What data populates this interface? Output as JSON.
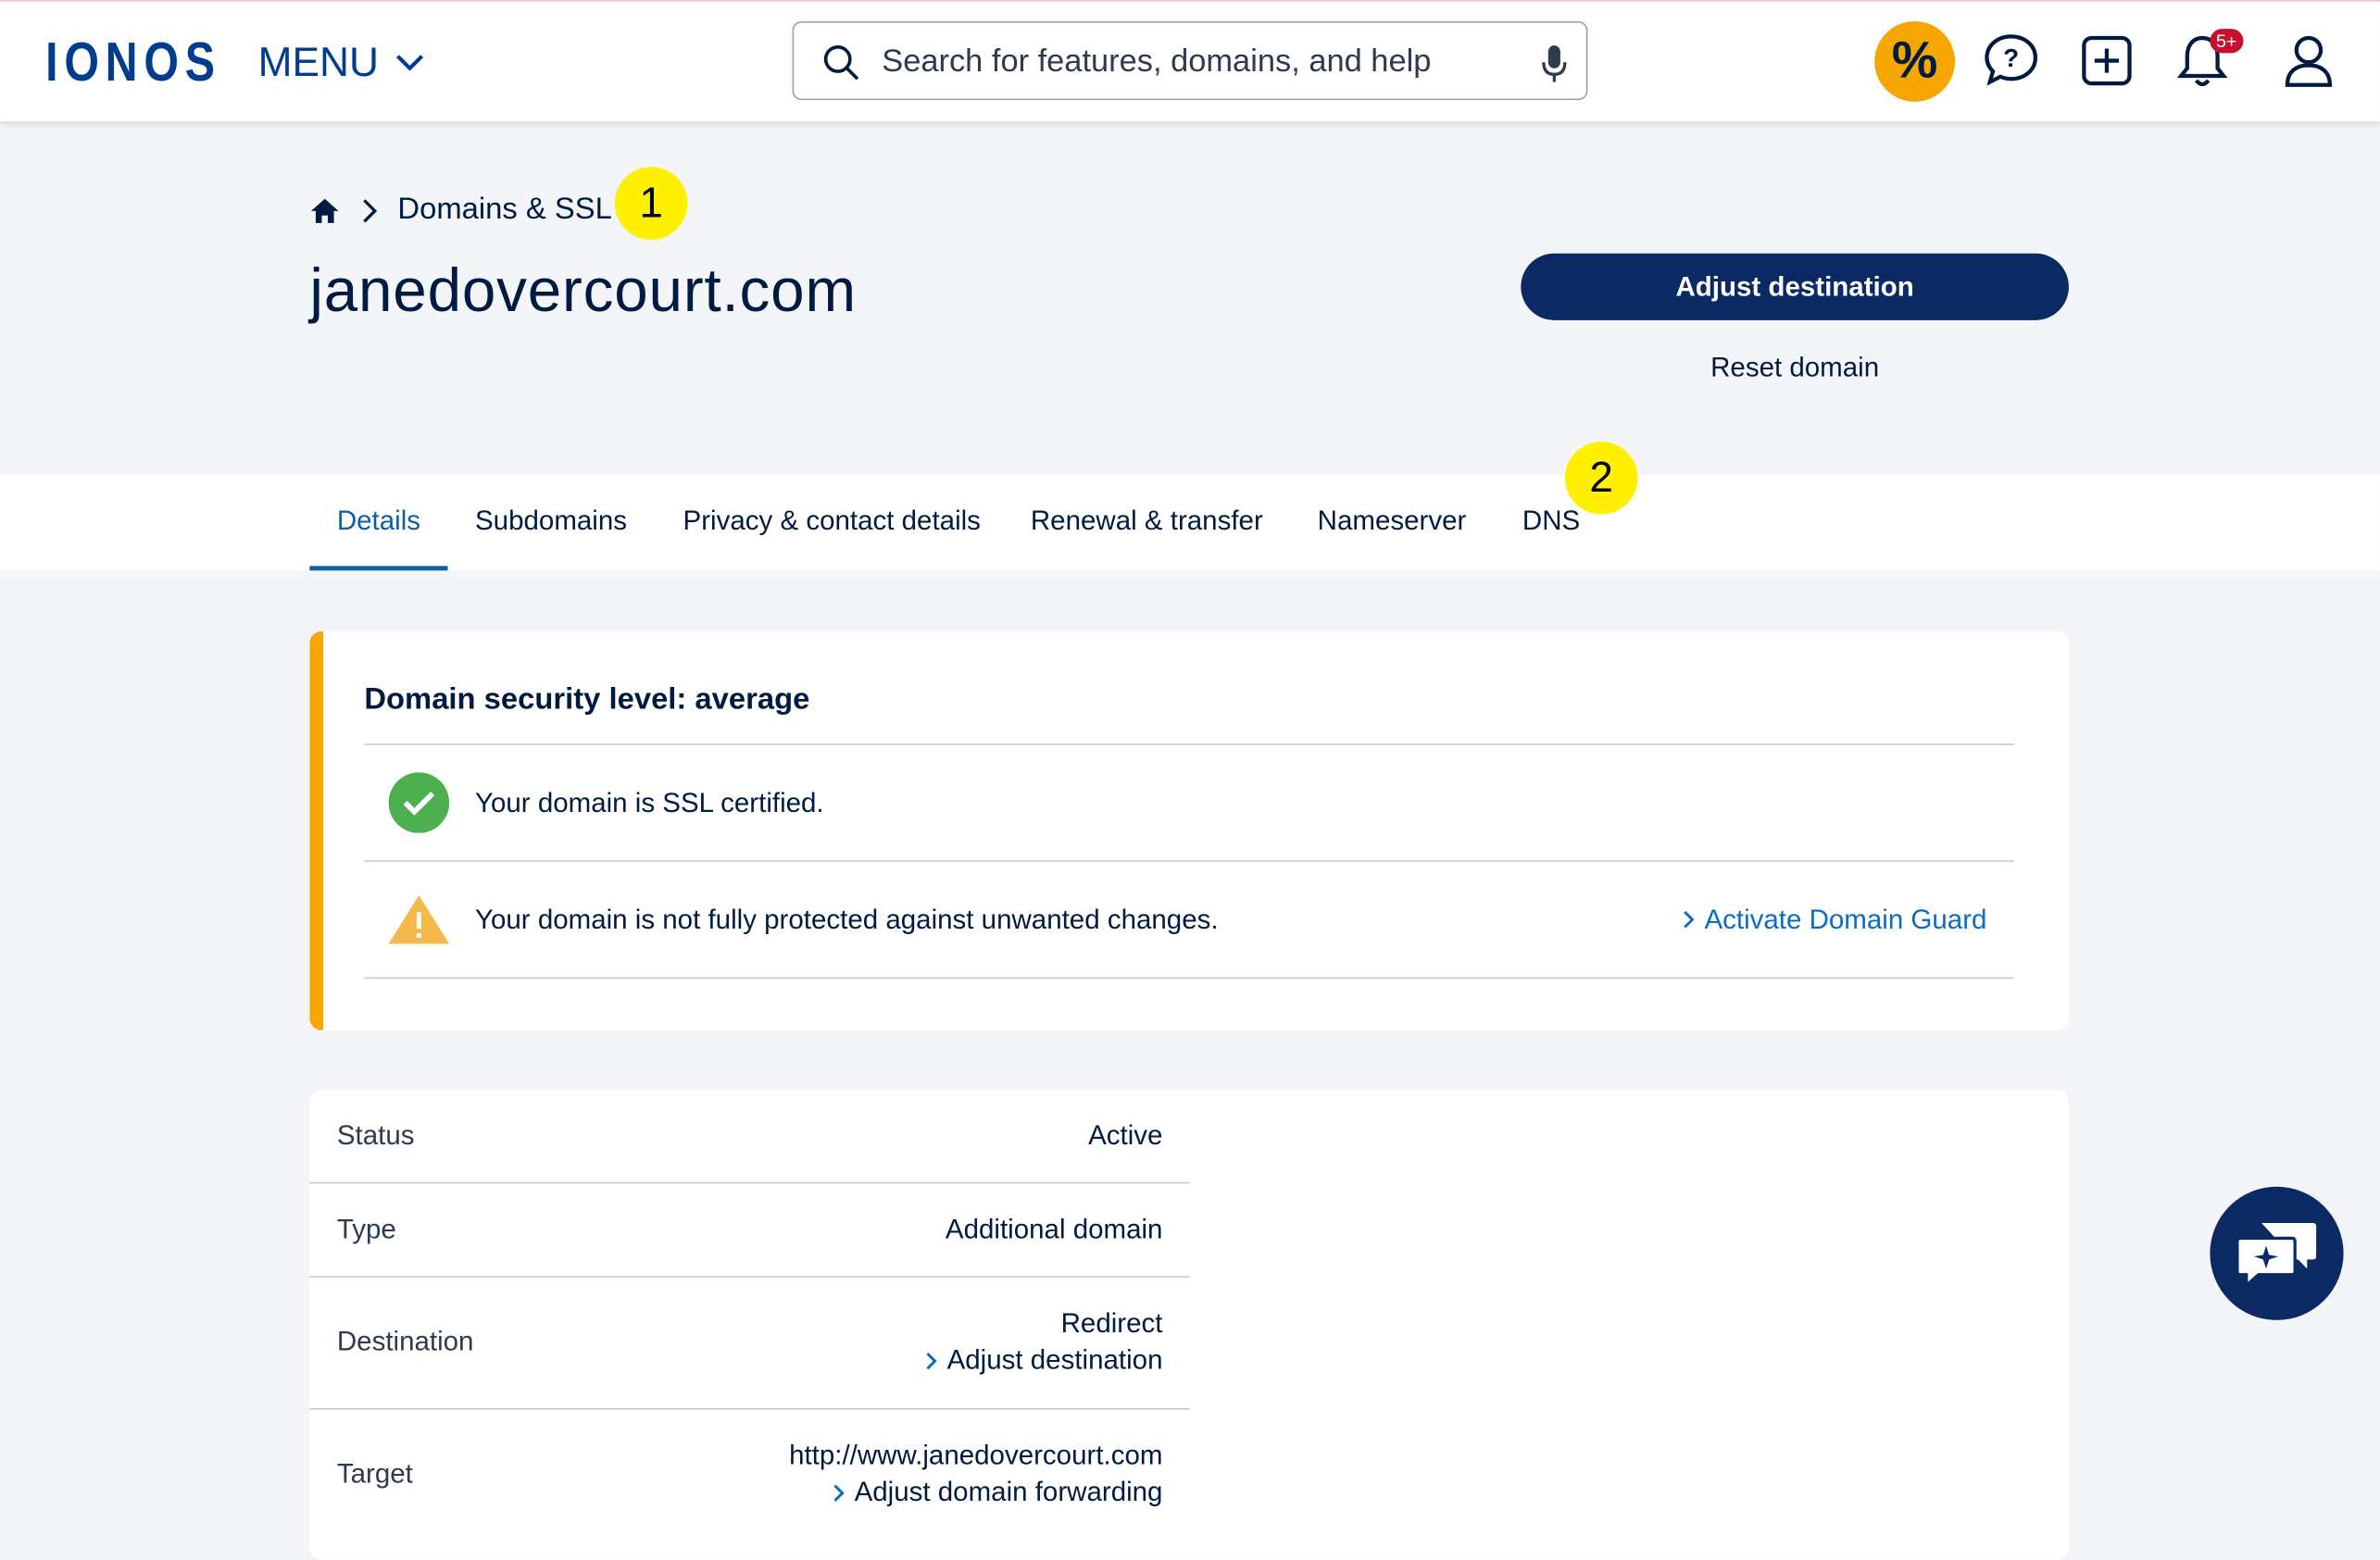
{
  "header": {
    "logo": "IONOS",
    "menu_label": "MENU",
    "search_placeholder": "Search for features, domains, and help",
    "promo_symbol": "%",
    "notifications_badge": "5+"
  },
  "breadcrumb": {
    "section": "Domains & SSL"
  },
  "markers": [
    "1",
    "2"
  ],
  "page": {
    "title": "janedovercourt.com",
    "primary_button": "Adjust destination",
    "secondary_link": "Reset domain"
  },
  "tabs": [
    "Details",
    "Subdomains",
    "Privacy & contact details",
    "Renewal & transfer",
    "Nameserver",
    "DNS"
  ],
  "security": {
    "title": "Domain security level: average",
    "ssl_text": "Your domain is SSL certified.",
    "protection_text": "Your domain is not fully protected against unwanted changes.",
    "protection_link": "Activate Domain Guard"
  },
  "details": {
    "status_label": "Status",
    "status_value": "Active",
    "type_label": "Type",
    "type_value": "Additional domain",
    "destination_label": "Destination",
    "destination_value": "Redirect",
    "destination_link": "Adjust destination",
    "target_label": "Target",
    "target_value": "http://www.janedovercourt.com",
    "target_link": "Adjust domain forwarding"
  },
  "colors": {
    "brand": "#003d8f",
    "primary_button": "#0b2a63",
    "accent_orange": "#f7a600",
    "link": "#0b6cc7",
    "success": "#4caf50",
    "warning": "#f5b84a",
    "marker": "#ffef00"
  }
}
